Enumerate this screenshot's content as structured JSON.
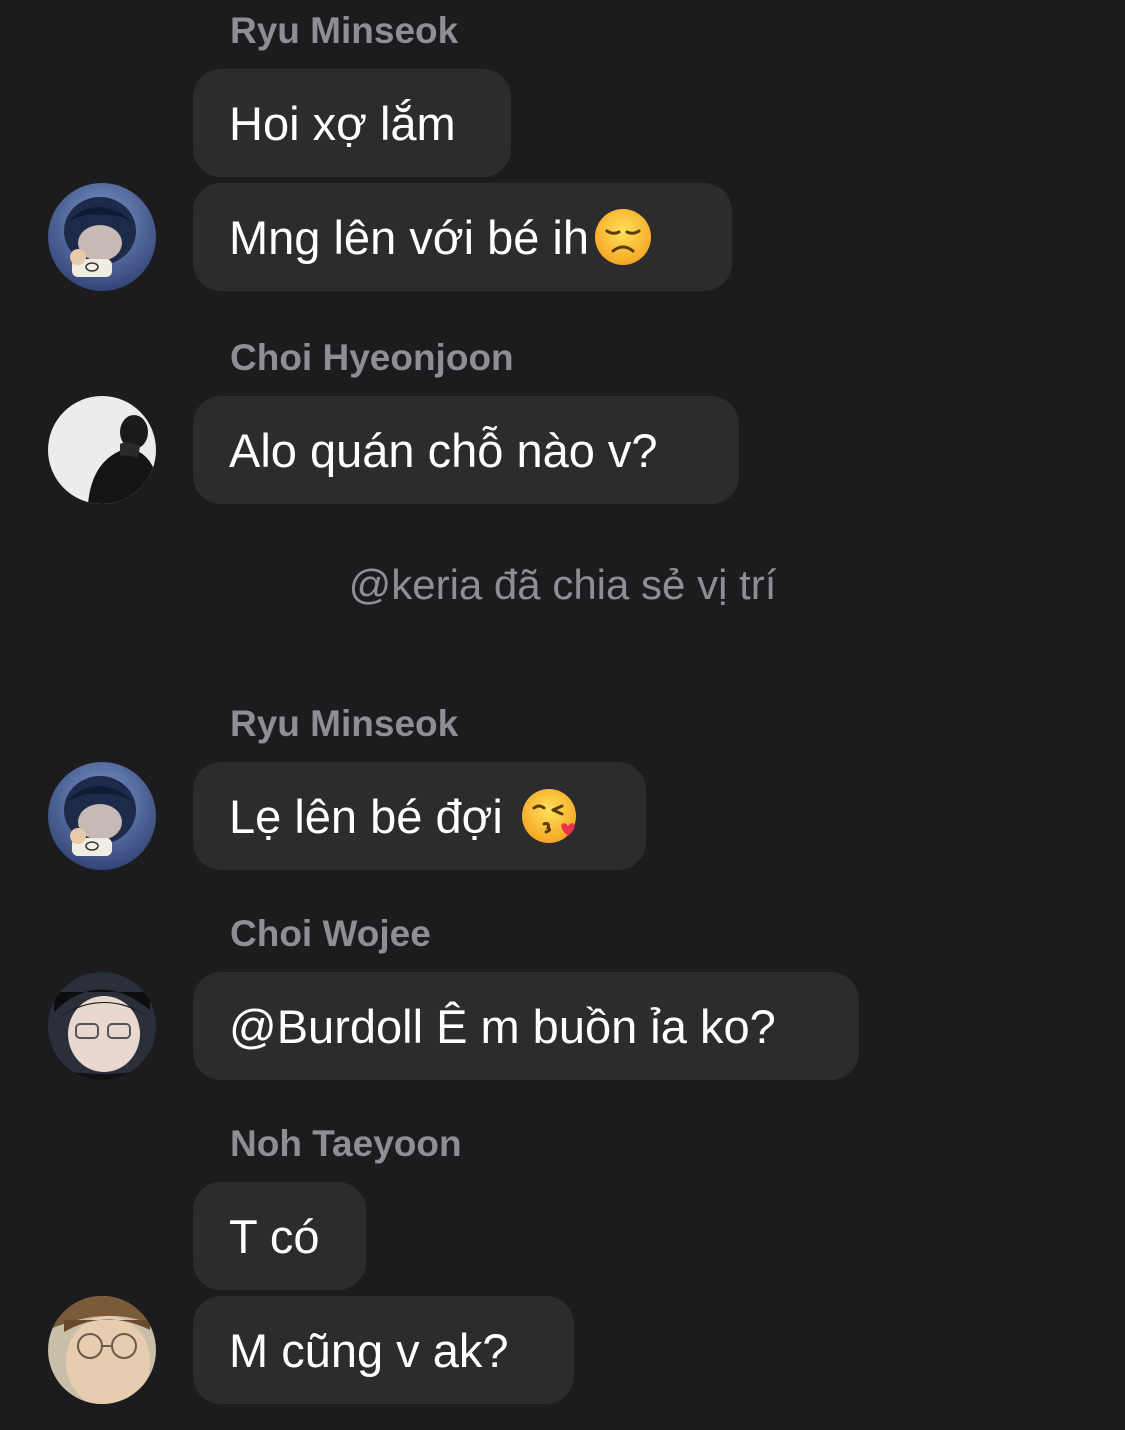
{
  "messages": [
    {
      "sender": "Ryu Minseok",
      "bubbles": [
        "Hoi xợ lắm",
        "Mng lên với bé ih"
      ],
      "emoji": "disappointed-face-emoji",
      "avatar": "ryu-minseok-avatar"
    },
    {
      "sender": "Choi Hyeonjoon",
      "bubbles": [
        "Alo quán chỗ nào v?"
      ],
      "avatar": "choi-hyeonjoon-avatar"
    },
    {
      "system": "@keria đã chia sẻ vị trí"
    },
    {
      "sender": "Ryu Minseok",
      "bubbles": [
        "Lẹ lên bé đợi "
      ],
      "emoji": "face-blowing-kiss-emoji",
      "avatar": "ryu-minseok-avatar"
    },
    {
      "sender": "Choi Wojee",
      "bubbles": [
        "@Burdoll Ê m buồn ỉa ko?"
      ],
      "avatar": "choi-wojee-avatar"
    },
    {
      "sender": "Noh Taeyoon",
      "bubbles": [
        "T có",
        "M cũng v ak?"
      ],
      "avatar": "noh-taeyoon-avatar"
    }
  ],
  "colors": {
    "background": "#1c1c1e",
    "bubble": "#2c2c2e",
    "sender_name": "#8e8e93",
    "message_text": "#ffffff",
    "system_text": "#8e8e93"
  }
}
